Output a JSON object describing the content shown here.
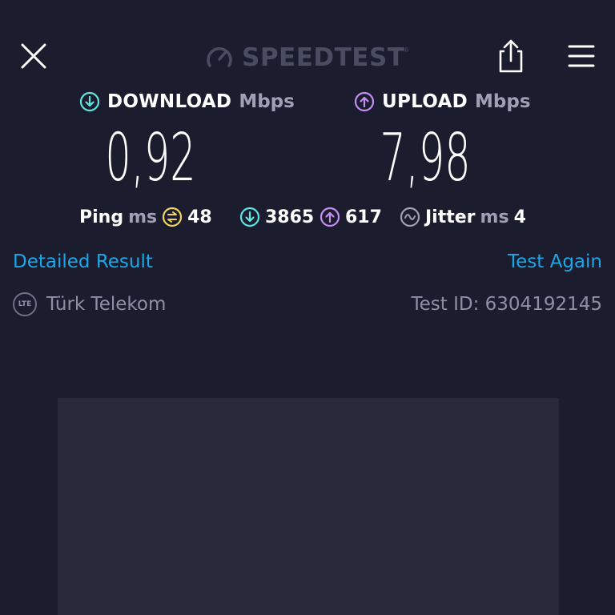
{
  "header": {
    "brand": "SPEEDTEST",
    "trademark": "®"
  },
  "download": {
    "label": "DOWNLOAD",
    "unit": "Mbps",
    "value": "0,92",
    "icon": "download-arrow-icon",
    "color": "#5ee5e0"
  },
  "upload": {
    "label": "UPLOAD",
    "unit": "Mbps",
    "value": "7,98",
    "icon": "upload-arrow-icon",
    "color": "#c48ef2"
  },
  "stats": {
    "ping_label": "Ping",
    "ping_unit": "ms",
    "ping_value": "48",
    "ping_icon_color": "#f1d65a",
    "download_latency": "3865",
    "upload_latency": "617",
    "jitter_label": "Jitter",
    "jitter_unit": "ms",
    "jitter_value": "4"
  },
  "links": {
    "detailed": "Detailed Result",
    "again": "Test Again",
    "color": "#1ba7e8"
  },
  "info": {
    "network_badge": "LTE",
    "provider": "Türk Telekom",
    "test_id": "Test ID: 6304192145"
  }
}
